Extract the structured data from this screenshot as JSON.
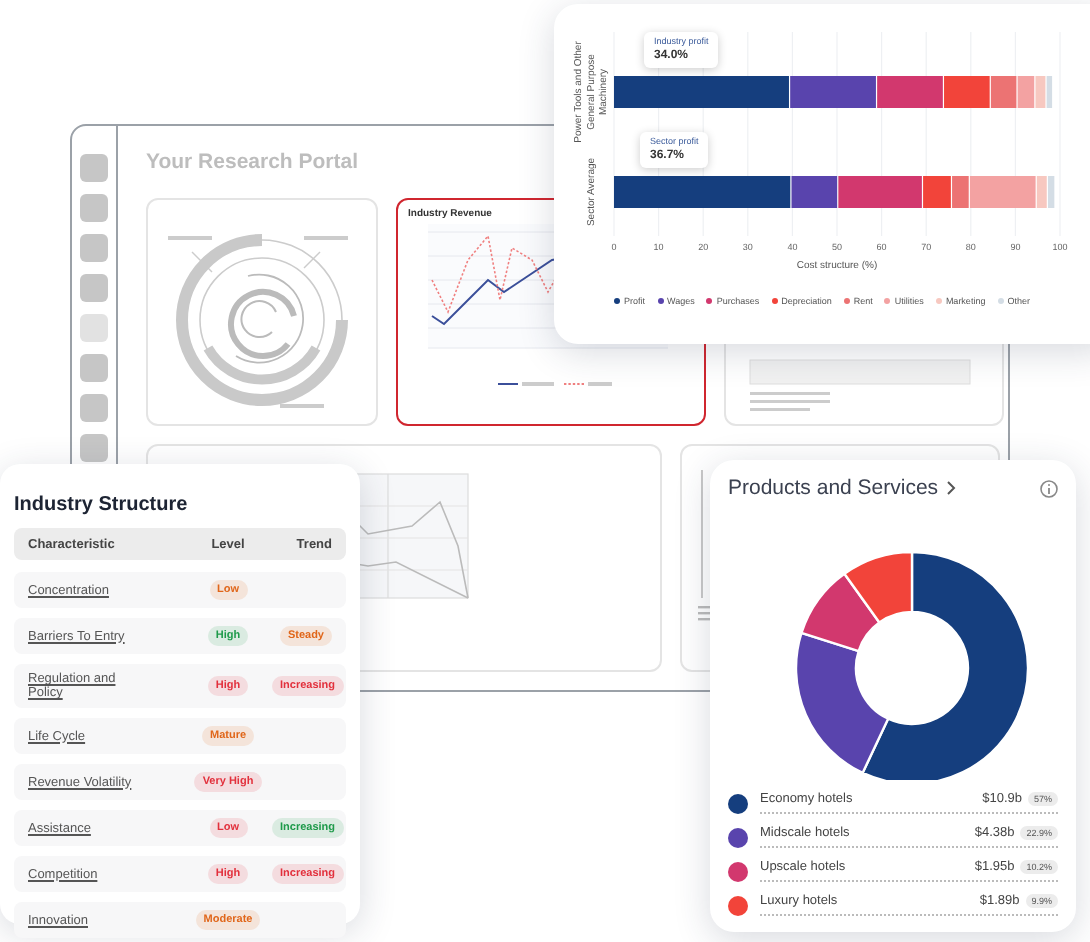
{
  "portal": {
    "title": "Your Research Portal",
    "nav": [
      {
        "selected": false
      },
      {
        "selected": false
      },
      {
        "selected": false
      },
      {
        "selected": false
      },
      {
        "selected": true
      },
      {
        "selected": false
      },
      {
        "selected": false
      },
      {
        "selected": false
      }
    ],
    "revenue_card": {
      "title": "Industry Revenue"
    }
  },
  "cost_structure": {
    "callouts": [
      {
        "label": "Industry profit",
        "value": "34.0%"
      },
      {
        "label": "Sector profit",
        "value": "36.7%"
      }
    ],
    "chart_data": {
      "type": "bar",
      "orientation": "horizontal",
      "stacked": true,
      "grid": true,
      "xlabel": "Cost structure (%)",
      "categories": [
        "Power Tools and Other General Purpose Machinery",
        "Sector Average"
      ],
      "xlim": [
        0,
        100
      ],
      "xticks": [
        0,
        10,
        20,
        30,
        40,
        50,
        60,
        70,
        80,
        90,
        100
      ],
      "series": [
        {
          "name": "Profit",
          "color": "#153e7e",
          "values": [
            39.5,
            39.8
          ]
        },
        {
          "name": "Wages",
          "color": "#5944ad",
          "values": [
            19.5,
            10.5
          ]
        },
        {
          "name": "Purchases",
          "color": "#d2386e",
          "values": [
            15,
            19
          ]
        },
        {
          "name": "Depreciation",
          "color": "#f2443a",
          "values": [
            10.5,
            6.5
          ]
        },
        {
          "name": "Rent",
          "color": "#ec7373",
          "values": [
            6,
            4
          ]
        },
        {
          "name": "Utilities",
          "color": "#f3a2a2",
          "values": [
            4,
            15
          ]
        },
        {
          "name": "Marketing",
          "color": "#f7c8c0",
          "values": [
            2.5,
            2.5
          ]
        },
        {
          "name": "Other",
          "color": "#d4dde5",
          "values": [
            1.5,
            1.7
          ]
        }
      ]
    }
  },
  "industry_structure": {
    "title": "Industry Structure",
    "columns": [
      "Characteristic",
      "Level",
      "Trend"
    ],
    "rows": [
      {
        "name": "Concentration",
        "level": {
          "text": "Low",
          "color": "#e0661a"
        }
      },
      {
        "name": "Barriers To Entry",
        "level": {
          "text": "High",
          "color": "#1e9a4a"
        },
        "trend": {
          "text": "Steady",
          "color": "#e0661a"
        }
      },
      {
        "name": "Regulation and Policy",
        "level": {
          "text": "High",
          "color": "#e2303c"
        },
        "trend": {
          "text": "Increasing",
          "color": "#e2303c"
        }
      },
      {
        "name": "Life Cycle",
        "level": {
          "text": "Mature",
          "color": "#e0661a"
        }
      },
      {
        "name": "Revenue Volatility",
        "level": {
          "text": "Very High",
          "color": "#e2303c"
        }
      },
      {
        "name": "Assistance",
        "level": {
          "text": "Low",
          "color": "#e2303c"
        },
        "trend": {
          "text": "Increasing",
          "color": "#1e9a4a"
        }
      },
      {
        "name": "Competition",
        "level": {
          "text": "High",
          "color": "#e2303c"
        },
        "trend": {
          "text": "Increasing",
          "color": "#e2303c"
        }
      },
      {
        "name": "Innovation",
        "level": {
          "text": "Moderate",
          "color": "#e0661a"
        }
      }
    ]
  },
  "products": {
    "title": "Products and Services",
    "chart_data": {
      "type": "donut",
      "categories": [
        "Economy hotels",
        "Midscale hotels",
        "Upscale hotels",
        "Luxury hotels"
      ],
      "values": [
        57,
        22.9,
        10.2,
        9.9
      ]
    },
    "items": [
      {
        "value": "$10.9b",
        "share": "57%",
        "color": "#153e7e"
      },
      {
        "value": "$4.38b",
        "share": "22.9%",
        "color": "#5944ad"
      },
      {
        "value": "$1.95b",
        "share": "10.2%",
        "color": "#d2386e"
      },
      {
        "value": "$1.89b",
        "share": "9.9%",
        "color": "#f2443a"
      }
    ]
  }
}
